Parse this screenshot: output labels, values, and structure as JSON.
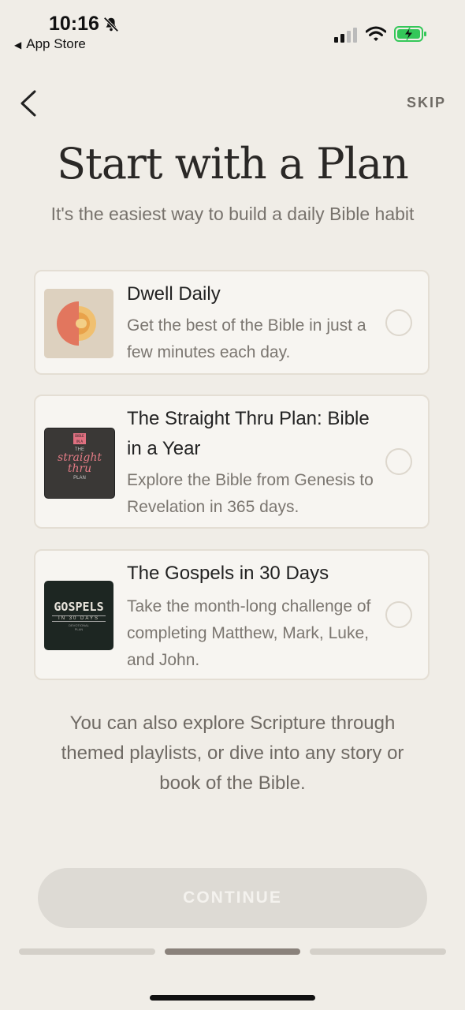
{
  "status_bar": {
    "time": "10:16",
    "back_label": "App Store",
    "icons": [
      "bell-slash-icon",
      "signal-icon",
      "wifi-icon",
      "battery-charging-icon"
    ]
  },
  "nav": {
    "back_icon": "chevron-left-icon",
    "skip_label": "SKIP"
  },
  "header": {
    "title": "Start with a Plan",
    "subtitle": "It's the easiest way to build a daily Bible habit"
  },
  "plans": [
    {
      "title": "Dwell Daily",
      "description": "Get the best of the Bible in just a few minutes each day.",
      "selected": false
    },
    {
      "title": "The Straight Thru Plan: Bible in a Year",
      "description": "Explore the Bible from Genesis to Revelation in 365 days.",
      "selected": false,
      "thumb_text": {
        "badge": "BIBLE IN A YEAR",
        "the": "THE",
        "line1": "straight",
        "line2": "thru",
        "plan": "PLAN"
      }
    },
    {
      "title": "The Gospels in 30 Days",
      "description": "Take the month-long challenge of completing Matthew, Mark, Luke, and John.",
      "selected": false,
      "thumb_text": {
        "main": "GOSPELS",
        "sub": "IN 30 DAYS",
        "small1": "DEVOTIONAL",
        "small2": "PLAN"
      }
    }
  ],
  "footer": {
    "text": "You can also explore Scripture through themed playlists, or dive into any story or book of the Bible."
  },
  "continue_label": "CONTINUE",
  "progress": {
    "steps": 3,
    "current_step": 2
  },
  "colors": {
    "background": "#f0ede7",
    "card": "#f7f5f1",
    "accent_active_progress": "#8a827b",
    "inactive_progress": "#d4d0c9",
    "battery_green": "#34c759"
  }
}
